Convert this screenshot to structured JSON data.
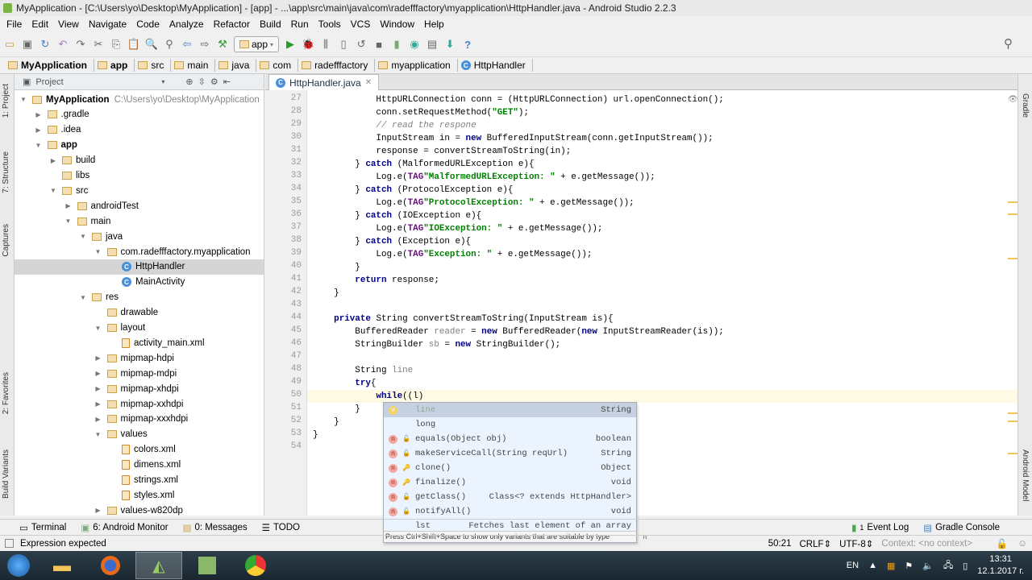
{
  "window": {
    "title": "MyApplication - [C:\\Users\\yo\\Desktop\\MyApplication] - [app] - ...\\app\\src\\main\\java\\com\\radefffactory\\myapplication\\HttpHandler.java - Android Studio 2.2.3"
  },
  "menu": [
    "File",
    "Edit",
    "View",
    "Navigate",
    "Code",
    "Analyze",
    "Refactor",
    "Build",
    "Run",
    "Tools",
    "VCS",
    "Window",
    "Help"
  ],
  "toolbar": {
    "run_config": "app"
  },
  "breadcrumbs": [
    "MyApplication",
    "app",
    "src",
    "main",
    "java",
    "com",
    "radefffactory",
    "myapplication",
    "HttpHandler"
  ],
  "left_strip": [
    "1: Project",
    "7: Structure",
    "Captures",
    "2: Favorites",
    "Build Variants"
  ],
  "right_strip": [
    "Gradle",
    "Android Model"
  ],
  "project": {
    "header": "Project",
    "tree": [
      {
        "label": "MyApplication",
        "note": "C:\\Users\\yo\\Desktop\\MyApplication",
        "level": 0,
        "arrow": "open",
        "icon": "folder",
        "bold": true
      },
      {
        "label": ".gradle",
        "level": 1,
        "arrow": "closed",
        "icon": "folder"
      },
      {
        "label": ".idea",
        "level": 1,
        "arrow": "closed",
        "icon": "folder"
      },
      {
        "label": "app",
        "level": 1,
        "arrow": "open",
        "icon": "folder",
        "bold": true
      },
      {
        "label": "build",
        "level": 2,
        "arrow": "closed",
        "icon": "folder"
      },
      {
        "label": "libs",
        "level": 2,
        "arrow": "none",
        "icon": "folder"
      },
      {
        "label": "src",
        "level": 2,
        "arrow": "open",
        "icon": "folder"
      },
      {
        "label": "androidTest",
        "level": 3,
        "arrow": "closed",
        "icon": "folder"
      },
      {
        "label": "main",
        "level": 3,
        "arrow": "open",
        "icon": "folder"
      },
      {
        "label": "java",
        "level": 4,
        "arrow": "open",
        "icon": "folder"
      },
      {
        "label": "com.radefffactory.myapplication",
        "level": 5,
        "arrow": "open",
        "icon": "folder"
      },
      {
        "label": "HttpHandler",
        "level": 6,
        "arrow": "none",
        "icon": "class",
        "selected": true
      },
      {
        "label": "MainActivity",
        "level": 6,
        "arrow": "none",
        "icon": "class"
      },
      {
        "label": "res",
        "level": 4,
        "arrow": "open",
        "icon": "folder"
      },
      {
        "label": "drawable",
        "level": 5,
        "arrow": "none",
        "icon": "folder"
      },
      {
        "label": "layout",
        "level": 5,
        "arrow": "open",
        "icon": "folder"
      },
      {
        "label": "activity_main.xml",
        "level": 6,
        "arrow": "none",
        "icon": "xml"
      },
      {
        "label": "mipmap-hdpi",
        "level": 5,
        "arrow": "closed",
        "icon": "folder"
      },
      {
        "label": "mipmap-mdpi",
        "level": 5,
        "arrow": "closed",
        "icon": "folder"
      },
      {
        "label": "mipmap-xhdpi",
        "level": 5,
        "arrow": "closed",
        "icon": "folder"
      },
      {
        "label": "mipmap-xxhdpi",
        "level": 5,
        "arrow": "closed",
        "icon": "folder"
      },
      {
        "label": "mipmap-xxxhdpi",
        "level": 5,
        "arrow": "closed",
        "icon": "folder"
      },
      {
        "label": "values",
        "level": 5,
        "arrow": "open",
        "icon": "folder"
      },
      {
        "label": "colors.xml",
        "level": 6,
        "arrow": "none",
        "icon": "xml"
      },
      {
        "label": "dimens.xml",
        "level": 6,
        "arrow": "none",
        "icon": "xml"
      },
      {
        "label": "strings.xml",
        "level": 6,
        "arrow": "none",
        "icon": "xml"
      },
      {
        "label": "styles.xml",
        "level": 6,
        "arrow": "none",
        "icon": "xml"
      },
      {
        "label": "values-w820dp",
        "level": 5,
        "arrow": "closed",
        "icon": "folder"
      }
    ]
  },
  "editor": {
    "tab": "HttpHandler.java",
    "current_line": 50,
    "lines": [
      {
        "n": 27,
        "s": [
          [
            "",
            "            HttpURLConnection conn = (HttpURLConnection) url.openConnection();"
          ]
        ]
      },
      {
        "n": 28,
        "s": [
          [
            "",
            "            conn.setRequestMethod("
          ],
          [
            "str",
            "\"GET\""
          ],
          [
            "",
            ");"
          ]
        ]
      },
      {
        "n": 29,
        "s": [
          [
            "cm",
            "            // read the respone"
          ]
        ]
      },
      {
        "n": 30,
        "s": [
          [
            "",
            "            InputStream in = "
          ],
          [
            "kw",
            "new"
          ],
          [
            "",
            " BufferedInputStream(conn.getInputStream());"
          ]
        ]
      },
      {
        "n": 31,
        "s": [
          [
            "",
            "            response = convertStreamToString(in);"
          ]
        ]
      },
      {
        "n": 32,
        "s": [
          [
            "",
            "        } "
          ],
          [
            "kw",
            "catch"
          ],
          [
            "",
            " (MalformedURLException e){"
          ]
        ]
      },
      {
        "n": 33,
        "s": [
          [
            "",
            "            Log.e("
          ],
          [
            "fld",
            "TAG"
          ],
          [
            ", "
          ],
          [
            "str",
            "\"MalformedURLException: \""
          ],
          [
            "",
            " + e.getMessage());"
          ]
        ]
      },
      {
        "n": 34,
        "s": [
          [
            "",
            "        } "
          ],
          [
            "kw",
            "catch"
          ],
          [
            "",
            " (ProtocolException e){"
          ]
        ]
      },
      {
        "n": 35,
        "s": [
          [
            "",
            "            Log.e("
          ],
          [
            "fld",
            "TAG"
          ],
          [
            ", "
          ],
          [
            "str",
            "\"ProtocolException: \""
          ],
          [
            "",
            " + e.getMessage());"
          ]
        ]
      },
      {
        "n": 36,
        "s": [
          [
            "",
            "        } "
          ],
          [
            "kw",
            "catch"
          ],
          [
            "",
            " (IOException e){"
          ]
        ]
      },
      {
        "n": 37,
        "s": [
          [
            "",
            "            Log.e("
          ],
          [
            "fld",
            "TAG"
          ],
          [
            ", "
          ],
          [
            "str",
            "\"IOException: \""
          ],
          [
            "",
            " + e.getMessage());"
          ]
        ]
      },
      {
        "n": 38,
        "s": [
          [
            "",
            "        } "
          ],
          [
            "kw",
            "catch"
          ],
          [
            "",
            " (Exception e){"
          ]
        ]
      },
      {
        "n": 39,
        "s": [
          [
            "",
            "            Log.e("
          ],
          [
            "fld",
            "TAG"
          ],
          [
            ", "
          ],
          [
            "str",
            "\"Exception: \""
          ],
          [
            "",
            " + e.getMessage());"
          ]
        ]
      },
      {
        "n": 40,
        "s": [
          [
            "",
            "        }"
          ]
        ]
      },
      {
        "n": 41,
        "s": [
          [
            "",
            "        "
          ],
          [
            "kw",
            "return"
          ],
          [
            "",
            " response;"
          ]
        ]
      },
      {
        "n": 42,
        "s": [
          [
            "",
            "    }"
          ]
        ]
      },
      {
        "n": 43,
        "s": [
          [
            "",
            ""
          ]
        ]
      },
      {
        "n": 44,
        "s": [
          [
            "",
            "    "
          ],
          [
            "kw",
            "private"
          ],
          [
            "",
            " String convertStreamToString(InputStream is){"
          ]
        ]
      },
      {
        "n": 45,
        "s": [
          [
            "",
            "        BufferedReader "
          ],
          [
            "unused",
            "reader"
          ],
          [
            "",
            " = "
          ],
          [
            "kw",
            "new"
          ],
          [
            "",
            " BufferedReader("
          ],
          [
            "kw",
            "new"
          ],
          [
            "",
            " InputStreamReader(is));"
          ]
        ]
      },
      {
        "n": 46,
        "s": [
          [
            "",
            "        StringBuilder "
          ],
          [
            "unused",
            "sb"
          ],
          [
            "",
            " = "
          ],
          [
            "kw",
            "new"
          ],
          [
            "",
            " StringBuilder();"
          ]
        ]
      },
      {
        "n": 47,
        "s": [
          [
            "",
            ""
          ]
        ]
      },
      {
        "n": 48,
        "s": [
          [
            "",
            "        String "
          ],
          [
            "unused",
            "line"
          ],
          [
            ";"
          ]
        ]
      },
      {
        "n": 49,
        "s": [
          [
            "",
            "        "
          ],
          [
            "kw",
            "try"
          ],
          [
            "",
            "{"
          ]
        ]
      },
      {
        "n": 50,
        "s": [
          [
            "",
            "            "
          ],
          [
            "kw",
            "while"
          ],
          [
            "",
            "((l)"
          ]
        ]
      },
      {
        "n": 51,
        "s": [
          [
            "",
            "        }"
          ]
        ]
      },
      {
        "n": 52,
        "s": [
          [
            "",
            "    }"
          ]
        ]
      },
      {
        "n": 53,
        "s": [
          [
            "",
            "}"
          ]
        ]
      },
      {
        "n": 54,
        "s": [
          [
            "",
            ""
          ]
        ]
      }
    ]
  },
  "completion": {
    "items": [
      {
        "badge": "v",
        "access": "",
        "name": "line",
        "type": "String",
        "selected": true
      },
      {
        "badge": "",
        "access": "",
        "name": "long",
        "type": ""
      },
      {
        "badge": "m",
        "access": "public",
        "name": "equals(Object obj)",
        "type": "boolean"
      },
      {
        "badge": "m",
        "access": "public",
        "name": "makeServiceCall(String reqUrl)",
        "type": "String"
      },
      {
        "badge": "m",
        "access": "protected",
        "name": "clone()",
        "type": "Object"
      },
      {
        "badge": "m",
        "access": "protected",
        "name": "finalize()",
        "type": "void"
      },
      {
        "badge": "m",
        "access": "public",
        "name": "getClass()",
        "type": "Class<? extends HttpHandler>"
      },
      {
        "badge": "m",
        "access": "public",
        "name": "notifyAll()",
        "type": "void"
      },
      {
        "badge": "",
        "access": "",
        "name": "lst",
        "type": "Fetches last element of an array"
      }
    ],
    "hint": "Press Ctrl+Shift+Space to show only variants that are suitable by type",
    "hint_icon": "π"
  },
  "bottom_tabs": [
    "Terminal",
    "6: Android Monitor",
    "0: Messages",
    "TODO"
  ],
  "bottom_right": {
    "event_log": "Event Log",
    "event_count": "1",
    "gradle_console": "Gradle Console"
  },
  "status": {
    "message": "Expression expected",
    "position": "50:21",
    "line_sep": "CRLF",
    "encoding": "UTF-8",
    "context": "Context: <no context>"
  },
  "taskbar": {
    "lang": "EN",
    "time": "13:31",
    "date": "12.1.2017 г."
  }
}
